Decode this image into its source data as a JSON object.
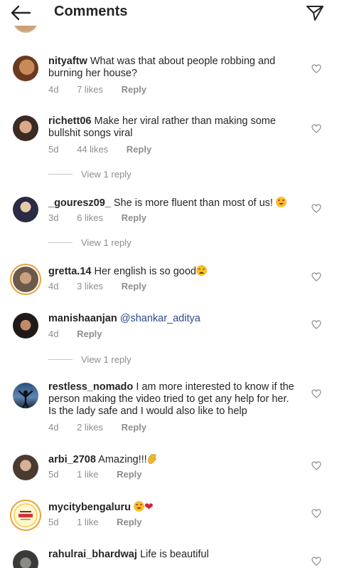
{
  "header": {
    "title": "Comments",
    "back_icon": "back-arrow-icon",
    "share_icon": "send-icon"
  },
  "comments": [
    {
      "username": "nityaftw",
      "text": "What was that about people robbing and burning her house?",
      "time": "4d",
      "likes": "7 likes",
      "reply": "Reply"
    },
    {
      "username": "richett06",
      "text": "Make her viral rather than making some bullshit songs viral",
      "time": "5d",
      "likes": "44 likes",
      "reply": "Reply",
      "view_replies": "View 1 reply"
    },
    {
      "username": "_gouresz09_",
      "text": "She is more fluent than most of us!",
      "emoji": "heart-eyes-emoji",
      "time": "3d",
      "likes": "6 likes",
      "reply": "Reply",
      "view_replies": "View 1 reply"
    },
    {
      "username": "gretta.14",
      "text": "Her english is so good",
      "emoji": "weary-face-emoji",
      "time": "4d",
      "likes": "3 likes",
      "reply": "Reply"
    },
    {
      "username": "manishaanjan",
      "text": "@shankar_aditya",
      "time": "4d",
      "reply": "Reply",
      "view_replies": "View 1 reply"
    },
    {
      "username": "restless_nomado",
      "text": "I am more interested to know if the person making the video tried to get any help for her. Is the lady safe and I would also like to help",
      "time": "4d",
      "likes": "2 likes",
      "reply": "Reply"
    },
    {
      "username": "arbi_2708",
      "text": "Amazing!!!",
      "emoji": "clapping-hands-emoji",
      "time": "5d",
      "likes": "1 like",
      "reply": "Reply"
    },
    {
      "username": "mycitybengaluru",
      "text": "",
      "emoji": "heart-eyes-emoji red-heart-emoji",
      "time": "5d",
      "likes": "1 like",
      "reply": "Reply"
    },
    {
      "username": "rahulrai_bhardwaj",
      "text": "Life is beautiful",
      "time": "",
      "likes": "",
      "reply": ""
    }
  ],
  "colors": {
    "text": "#262626",
    "meta": "#8e8e8e",
    "mention": "#2b4a8a",
    "story_ring": "#e8a23a"
  }
}
